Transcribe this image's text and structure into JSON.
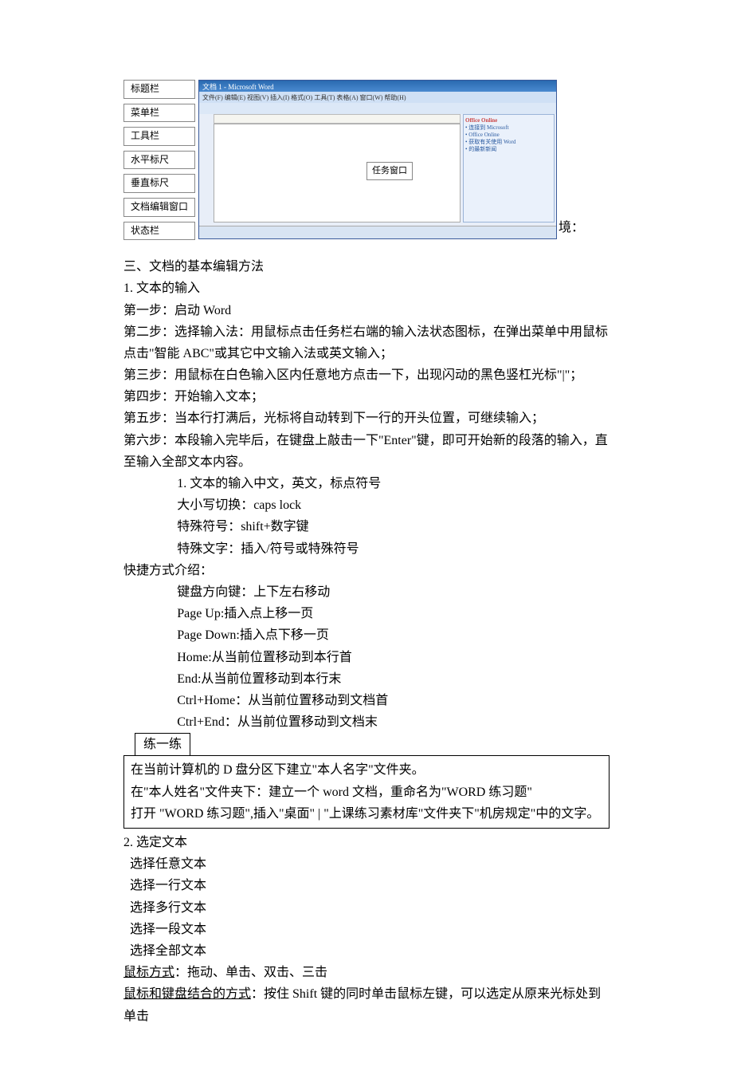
{
  "figure": {
    "labels": [
      "标题栏",
      "菜单栏",
      "工具栏",
      "水平标尺",
      "垂直标尺",
      "文档编辑窗口",
      "状态栏"
    ],
    "titlebar": "文档 1 - Microsoft Word",
    "menubar": "文件(F) 编辑(E) 视图(V) 插入(I) 格式(O) 工具(T) 表格(A) 窗口(W) 帮助(H)",
    "callout": "任务窗口",
    "panelHeader": "Office Online",
    "trail": "境："
  },
  "body": {
    "h3": "三、文档的基本编辑方法",
    "s1_title": "1. 文本的输入",
    "s1_step1": "第一步：启动 Word",
    "s1_step2": "第二步：选择输入法：用鼠标点击任务栏右端的输入法状态图标，在弹出菜单中用鼠标点击\"智能 ABC\"或其它中文输入法或英文输入；",
    "s1_step3": "第三步：用鼠标在白色输入区内任意地方点击一下，出现闪动的黑色竖杠光标\"|\"；",
    "s1_step4": "第四步：开始输入文本；",
    "s1_step5": "第五步：当本行打满后，光标将自动转到下一行的开头位置，可继续输入；",
    "s1_step6": "第六步：本段输入完毕后，在键盘上敲击一下\"Enter\"键，即可开始新的段落的输入，直至输入全部文本内容。",
    "sub1": "1.   文本的输入中文，英文，标点符号",
    "sub2": "大小写切换：caps lock",
    "sub3": "特殊符号：shift+数字键",
    "sub4": "特殊文字：插入/符号或特殊符号",
    "shortcuts_title": "快捷方式介绍：",
    "sc1": "键盘方向键：上下左右移动",
    "sc2": "Page Up:插入点上移一页",
    "sc3": "Page Down:插入点下移一页",
    "sc4": "Home:从当前位置移动到本行首",
    "sc5": "End:从当前位置移动到本行末",
    "sc6": "Ctrl+Home：从当前位置移动到文档首",
    "sc7": "Ctrl+End：从当前位置移动到文档末",
    "practice_tab": "练一练",
    "practice1": "在当前计算机的 D 盘分区下建立\"本人名字\"文件夹。",
    "practice2": "在\"本人姓名\"文件夹下：建立一个 word 文档，重命名为\"WORD 练习题\"",
    "practice3": "打开 \"WORD 练习题\",插入\"桌面\" | \"上课练习素材库\"文件夹下\"机房规定\"中的文字。",
    "s2_title": "2. 选定文本",
    "sel1": "选择任意文本",
    "sel2": "选择一行文本",
    "sel3": "选择多行文本",
    "sel4": "选择一段文本",
    "sel5": "选择全部文本",
    "mouse_label": "鼠标方式",
    "mouse_rest": "：拖动、单击、双击、三击",
    "combo_label": "鼠标和键盘结合的方式",
    "combo_rest": "：按住 Shift 键的同时单击鼠标左键，可以选定从原来光标处到单击"
  }
}
